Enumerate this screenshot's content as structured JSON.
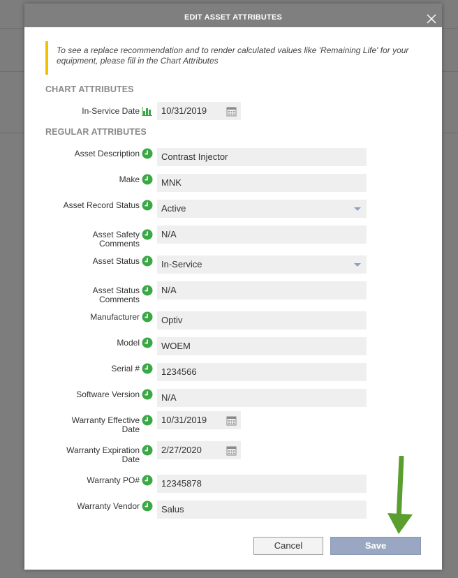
{
  "modal": {
    "title": "EDIT ASSET ATTRIBUTES",
    "notice": "To see a replace recommendation and to render calculated values like 'Remaining Life' for your equipment, please fill in the Chart Attributes"
  },
  "chart_section": {
    "heading": "CHART ATTRIBUTES",
    "in_service_date": {
      "label": "In-Service Date",
      "value": "10/31/2019"
    }
  },
  "regular_section": {
    "heading": "REGULAR ATTRIBUTES",
    "fields": {
      "asset_description": {
        "label": "Asset Description",
        "value": "Contrast Injector"
      },
      "make": {
        "label": "Make",
        "value": "MNK"
      },
      "asset_record_status": {
        "label": "Asset Record Status",
        "value": "Active"
      },
      "asset_safety_comments": {
        "label1": "Asset Safety",
        "label2": "Comments",
        "value": "N/A"
      },
      "asset_status": {
        "label": "Asset Status",
        "value": "In-Service"
      },
      "asset_status_comments": {
        "label1": "Asset Status",
        "label2": "Comments",
        "value": "N/A"
      },
      "manufacturer": {
        "label": "Manufacturer",
        "value": "Optiv"
      },
      "model": {
        "label": "Model",
        "value": "WOEM"
      },
      "serial": {
        "label": "Serial #",
        "value": "1234566"
      },
      "software_version": {
        "label": "Software Version",
        "value": "N/A"
      },
      "warranty_effective_date": {
        "label1": "Warranty Effective",
        "label2": "Date",
        "value": "10/31/2019"
      },
      "warranty_expiration_date": {
        "label1": "Warranty Expiration",
        "label2": "Date",
        "value": "2/27/2020"
      },
      "warranty_po": {
        "label": "Warranty PO#",
        "value": "12345878"
      },
      "warranty_vendor": {
        "label": "Warranty Vendor",
        "value": "Salus"
      }
    }
  },
  "buttons": {
    "cancel": "Cancel",
    "save": "Save"
  },
  "icons": {
    "status_dot": "clock-check-icon",
    "chart": "bar-chart-icon",
    "calendar": "calendar-icon",
    "close": "close-icon",
    "arrow": "arrow-down-icon"
  },
  "colors": {
    "header": "#7f7f7f",
    "notice_accent": "#f2c200",
    "status_green": "#3aa845",
    "save_button": "#99a7c2",
    "arrow_green": "#5a9e2f"
  }
}
